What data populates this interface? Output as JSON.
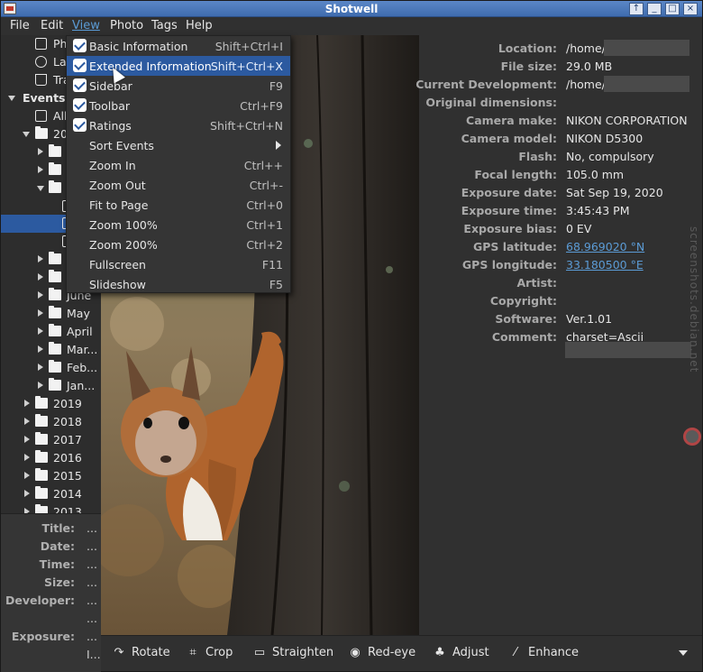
{
  "window": {
    "title": "Shotwell",
    "controls": [
      "↑",
      "_",
      "□",
      "×"
    ]
  },
  "menubar": [
    "File",
    "Edit",
    "View",
    "Photo",
    "Tags",
    "Help"
  ],
  "sidebar": {
    "items": [
      {
        "label": "Ph",
        "icon": "photos-icon"
      },
      {
        "label": "La",
        "icon": "clock-icon"
      },
      {
        "label": "Tra",
        "icon": "trash-icon"
      },
      {
        "label": "Events"
      },
      {
        "label": "All",
        "icon": "events-icon"
      },
      {
        "label": "20"
      },
      {
        "label": ""
      },
      {
        "label": ""
      },
      {
        "label": ""
      },
      {
        "label": ""
      },
      {
        "label": ""
      },
      {
        "label": ""
      },
      {
        "label": ""
      },
      {
        "label": ""
      },
      {
        "label": "June"
      },
      {
        "label": "May"
      },
      {
        "label": "April"
      },
      {
        "label": "Mar..."
      },
      {
        "label": "Feb..."
      },
      {
        "label": "Jan..."
      },
      {
        "label": "2019"
      },
      {
        "label": "2018"
      },
      {
        "label": "2017"
      },
      {
        "label": "2016"
      },
      {
        "label": "2015"
      },
      {
        "label": "2014"
      },
      {
        "label": "2013"
      }
    ]
  },
  "info_panel": [
    {
      "key": "Title:",
      "value": "..."
    },
    {
      "key": "Date:",
      "value": "..."
    },
    {
      "key": "Time:",
      "value": "..."
    },
    {
      "key": "Size:",
      "value": "..."
    },
    {
      "key": "Developer:",
      "value": "..."
    },
    {
      "key": "",
      "value": "..."
    },
    {
      "key": "Exposure:",
      "value": "..."
    },
    {
      "key": "",
      "value": "I..."
    }
  ],
  "view_menu": [
    {
      "label": "Basic Information",
      "accel": "Shift+Ctrl+I",
      "checked": true
    },
    {
      "label": "Extended Information",
      "accel": "Shift+Ctrl+X",
      "checked": true,
      "highlighted": true
    },
    {
      "label": "Sidebar",
      "accel": "F9",
      "checked": true
    },
    {
      "label": "Toolbar",
      "accel": "Ctrl+F9",
      "checked": true
    },
    {
      "label": "Ratings",
      "accel": "Shift+Ctrl+N",
      "checked": true
    },
    {
      "label": "Sort Events",
      "accel": "",
      "submenu": true
    },
    {
      "label": "Zoom In",
      "accel": "Ctrl++"
    },
    {
      "label": "Zoom Out",
      "accel": "Ctrl+-"
    },
    {
      "label": "Fit to Page",
      "accel": "Ctrl+0"
    },
    {
      "label": "Zoom 100%",
      "accel": "Ctrl+1"
    },
    {
      "label": "Zoom 200%",
      "accel": "Ctrl+2"
    },
    {
      "label": "Fullscreen",
      "accel": "F11"
    },
    {
      "label": "Slideshow",
      "accel": "F5"
    }
  ],
  "metadata": [
    {
      "key": "Location:",
      "value": "/home/"
    },
    {
      "key": "File size:",
      "value": "29.0  MB"
    },
    {
      "key": "Current Development:",
      "value": "/home/"
    },
    {
      "key": "Original dimensions:",
      "value": ""
    },
    {
      "key": "Camera make:",
      "value": "NIKON CORPORATION"
    },
    {
      "key": "Camera model:",
      "value": "NIKON D5300"
    },
    {
      "key": "Flash:",
      "value": "No, compulsory"
    },
    {
      "key": "Focal length:",
      "value": "105.0 mm"
    },
    {
      "key": "Exposure date:",
      "value": "Sat Sep 19, 2020"
    },
    {
      "key": "Exposure time:",
      "value": "3:45:43 PM"
    },
    {
      "key": "Exposure bias:",
      "value": "0 EV"
    },
    {
      "key": "GPS latitude:",
      "value": "68.969020 °N",
      "link": true
    },
    {
      "key": "GPS longitude:",
      "value": "33.180500 °E",
      "link": true
    },
    {
      "key": "Artist:",
      "value": ""
    },
    {
      "key": "Copyright:",
      "value": ""
    },
    {
      "key": "Software:",
      "value": "Ver.1.01"
    },
    {
      "key": "Comment:",
      "value": "charset=Ascii"
    }
  ],
  "watermark": "screenshots.debian.net",
  "toolbar": [
    {
      "label": "Rotate",
      "icon": "rotate-icon",
      "glyph": "↷"
    },
    {
      "label": "Crop",
      "icon": "crop-icon",
      "glyph": "⌗"
    },
    {
      "label": "Straighten",
      "icon": "straighten-icon",
      "glyph": "▭"
    },
    {
      "label": "Red-eye",
      "icon": "red-eye-icon",
      "glyph": "◉"
    },
    {
      "label": "Adjust",
      "icon": "adjust-icon",
      "glyph": "♣"
    },
    {
      "label": "Enhance",
      "icon": "enhance-icon",
      "glyph": "⁄"
    }
  ]
}
